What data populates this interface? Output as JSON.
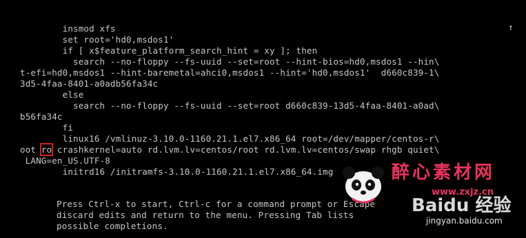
{
  "editor": {
    "lines": [
      "        insmod xfs",
      "        set root='hd0,msdos1'",
      "        if [ x$feature_platform_search_hint = xy ]; then",
      "          search --no-floppy --fs-uuid --set=root --hint-bios=hd0,msdos1 --hin\\",
      "t-efi=hd0,msdos1 --hint-baremetal=ahci0,msdos1 --hint='hd0,msdos1'  d660c839-1\\",
      "3d5-4faa-8401-a0adb56fa34c",
      "        else",
      "          search --no-floppy --fs-uuid --set=root d660c839-13d5-4faa-8401-a0ad\\",
      "b56fa34c",
      "        fi",
      "        linux16 /vmlinuz-3.10.0-1160.21.1.el7.x86_64 root=/dev/mapper/centos-r\\"
    ],
    "line_ro_before": "oot ",
    "line_ro_highlight": "ro",
    "line_ro_after": " crashkernel=auto rd.lvm.lv=centos/root rd.lvm.lv=centos/swap rhgb quiet\\",
    "line_lang": " LANG=en_US.UTF-8",
    "line_initrd": "        initrd16 /initramfs-3.10.0-1160.21.1.el7.x86_64.img"
  },
  "scroll_indicator": "↑",
  "help": {
    "lines": [
      "Press Ctrl-x to start, Ctrl-c for a command prompt or Escape",
      "discard edits and return to the menu. Pressing Tab lists",
      "possible completions."
    ]
  },
  "watermark": {
    "site_cn": "醉心素材网",
    "site_url": "www.zxjz.cn",
    "baidu_text": "Baidu 经验",
    "baidu_url": "jingyan.baidu.com"
  },
  "colors": {
    "background": "#000000",
    "text": "#c7c7c7",
    "highlight_box": "#d42020",
    "watermark_pink": "#e8335f"
  }
}
